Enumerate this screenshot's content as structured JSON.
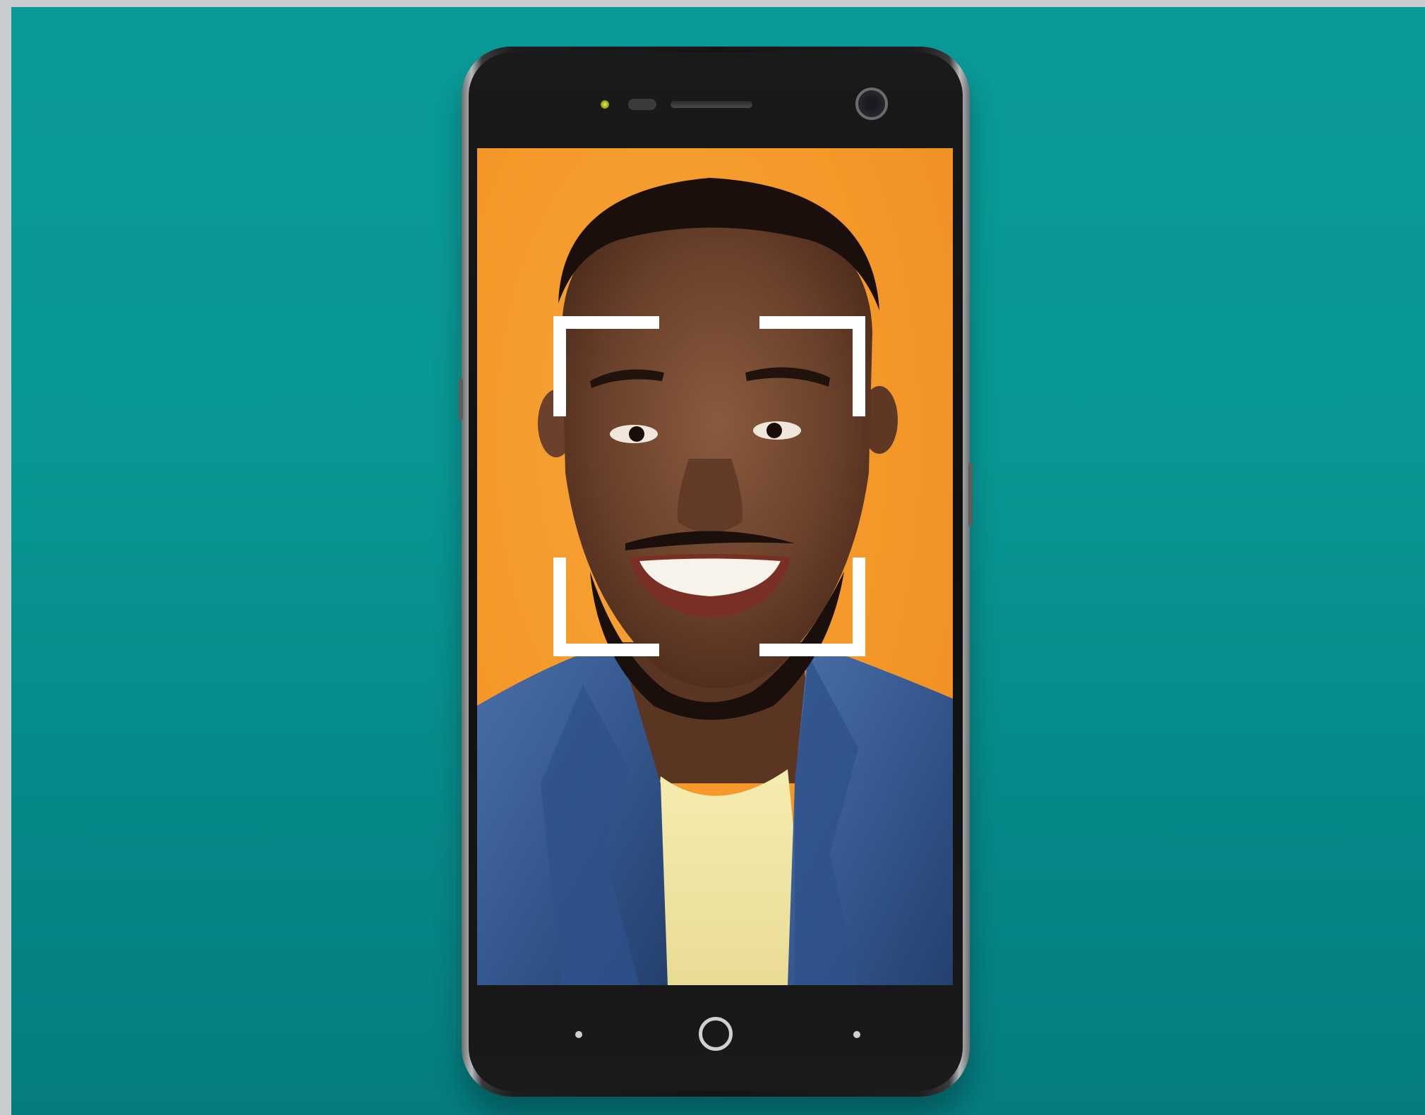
{
  "scene": {
    "background_color": "#089794",
    "screen_background_color": "#f59a2a",
    "frame_color": "#ffffff",
    "subject": "smiling-man-portrait",
    "icons": [
      "face-recognition-frame-icon",
      "home-button-icon",
      "front-camera-icon"
    ]
  }
}
